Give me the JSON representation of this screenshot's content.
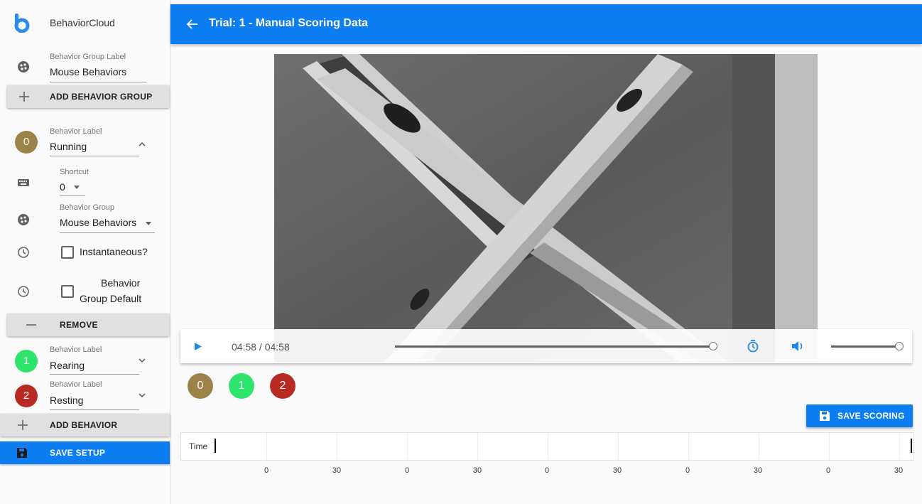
{
  "app": {
    "name": "BehaviorCloud"
  },
  "sidebar": {
    "group_field": {
      "label": "Behavior Group Label",
      "value": "Mouse Behaviors"
    },
    "add_group_label": "ADD BEHAVIOR GROUP",
    "behavior_expanded": {
      "index": "0",
      "color": "#9c8148",
      "label_caption": "Behavior Label",
      "label_value": "Running",
      "shortcut_caption": "Shortcut",
      "shortcut_value": "0",
      "group_caption": "Behavior Group",
      "group_value": "Mouse Behaviors",
      "instantaneous_label": "Instantaneous?",
      "instantaneous_checked": false,
      "group_default_label_line1": "Behavior",
      "group_default_label_line2": "Group Default",
      "group_default_checked": false
    },
    "remove_label": "REMOVE",
    "behaviors_collapsed": [
      {
        "index": "1",
        "color": "#2ee56c",
        "caption": "Behavior Label",
        "value": "Rearing"
      },
      {
        "index": "2",
        "color": "#b92a22",
        "caption": "Behavior Label",
        "value": "Resting"
      }
    ],
    "add_behavior_label": "ADD BEHAVIOR",
    "save_setup_label": "SAVE SETUP"
  },
  "header": {
    "title": "Trial: 1 - Manual Scoring Data"
  },
  "player": {
    "time_readout": "04:58 / 04:58",
    "progress": 1.0,
    "volume": 1.0
  },
  "behavior_buttons": [
    {
      "label": "0",
      "color": "#9c8148"
    },
    {
      "label": "1",
      "color": "#2ee56c"
    },
    {
      "label": "2",
      "color": "#b92a22"
    }
  ],
  "save_scoring_label": "SAVE SCORING",
  "timeline": {
    "label": "Time",
    "ticks": [
      "0",
      "30",
      "0",
      "30",
      "0",
      "30",
      "0",
      "30",
      "0",
      "30"
    ]
  },
  "colors": {
    "primary": "#0d7ef2",
    "bar_gray": "#e0e0e0"
  },
  "icons": [
    "logo-b-icon",
    "palette-icon",
    "plus-icon",
    "keyboard-icon",
    "clock-icon",
    "minus-icon",
    "save-icon",
    "back-arrow-icon",
    "play-icon",
    "replay-timer-icon",
    "volume-icon",
    "chevron-up-icon",
    "chevron-down-icon",
    "dropdown-arrow-icon"
  ]
}
